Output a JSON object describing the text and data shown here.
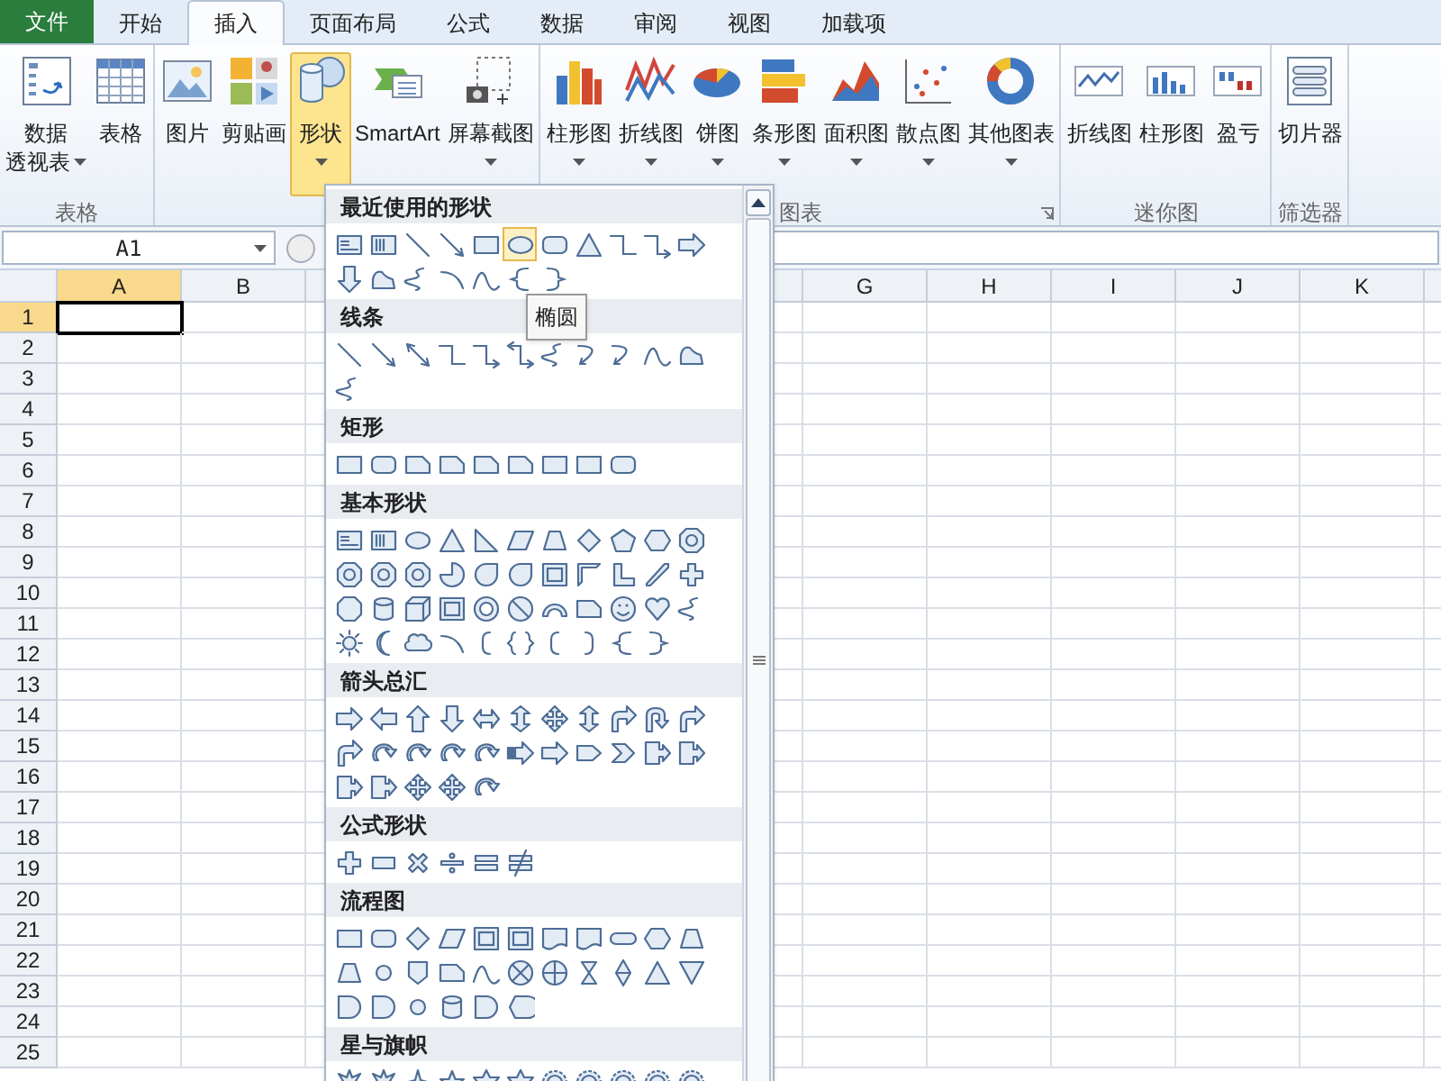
{
  "tabs": [
    {
      "label": "文件",
      "kind": "file",
      "selected": false
    },
    {
      "label": "开始",
      "kind": "tab",
      "selected": false
    },
    {
      "label": "插入",
      "kind": "tab",
      "selected": true
    },
    {
      "label": "页面布局",
      "kind": "tab",
      "selected": false
    },
    {
      "label": "公式",
      "kind": "tab",
      "selected": false
    },
    {
      "label": "数据",
      "kind": "tab",
      "selected": false
    },
    {
      "label": "审阅",
      "kind": "tab",
      "selected": false
    },
    {
      "label": "视图",
      "kind": "tab",
      "selected": false
    },
    {
      "label": "加载项",
      "kind": "tab",
      "selected": false
    }
  ],
  "ribbon_groups": [
    {
      "label": "表格",
      "launcher": false,
      "buttons": [
        {
          "kind": "pivot",
          "lines": [
            "数据",
            "透视表"
          ],
          "dropdown": true,
          "pressed": false
        },
        {
          "kind": "table",
          "lines": [
            "表格"
          ],
          "dropdown": false,
          "pressed": false
        }
      ]
    },
    {
      "launcher": false,
      "buttons": [
        {
          "kind": "picture",
          "lines": [
            "图片"
          ],
          "dropdown": false,
          "pressed": false
        },
        {
          "kind": "clipart",
          "lines": [
            "剪贴画"
          ],
          "dropdown": false,
          "pressed": false
        },
        {
          "kind": "shapes",
          "lines": [
            "形状"
          ],
          "dropdown": true,
          "pressed": true
        },
        {
          "kind": "smartart",
          "lines": [
            "SmartArt"
          ],
          "dropdown": false,
          "pressed": false
        },
        {
          "kind": "screenshot",
          "lines": [
            "屏幕截图"
          ],
          "dropdown": true,
          "pressed": false
        }
      ]
    },
    {
      "label": "图表",
      "launcher": true,
      "buttons": [
        {
          "kind": "column",
          "lines": [
            "柱形图"
          ],
          "dropdown": true,
          "pressed": false
        },
        {
          "kind": "line",
          "lines": [
            "折线图"
          ],
          "dropdown": true,
          "pressed": false
        },
        {
          "kind": "pie",
          "lines": [
            "饼图"
          ],
          "dropdown": true,
          "pressed": false
        },
        {
          "kind": "bar",
          "lines": [
            "条形图"
          ],
          "dropdown": true,
          "pressed": false
        },
        {
          "kind": "area",
          "lines": [
            "面积图"
          ],
          "dropdown": true,
          "pressed": false
        },
        {
          "kind": "scatter",
          "lines": [
            "散点图"
          ],
          "dropdown": true,
          "pressed": false
        },
        {
          "kind": "donut",
          "lines": [
            "其他图表"
          ],
          "dropdown": true,
          "pressed": false
        }
      ]
    },
    {
      "label": "迷你图",
      "launcher": false,
      "buttons": [
        {
          "kind": "sparkline",
          "lines": [
            "折线图"
          ],
          "dropdown": false,
          "pressed": false
        },
        {
          "kind": "sparkcolumn",
          "lines": [
            "柱形图"
          ],
          "dropdown": false,
          "pressed": false
        },
        {
          "kind": "winloss",
          "lines": [
            "盈亏"
          ],
          "dropdown": false,
          "pressed": false
        }
      ]
    },
    {
      "label": "筛选器",
      "launcher": false,
      "buttons": [
        {
          "kind": "slicer",
          "lines": [
            "切片器"
          ],
          "dropdown": false,
          "pressed": false
        }
      ]
    }
  ],
  "name_box": {
    "value": "A1"
  },
  "columns": [
    {
      "kind": "label",
      "label": "A",
      "selected": true
    },
    {
      "kind": "label",
      "label": "B",
      "selected": false
    },
    {
      "kind": "covered"
    },
    {
      "kind": "covered"
    },
    {
      "kind": "covered"
    },
    {
      "kind": "covered"
    },
    {
      "kind": "label",
      "label": "G",
      "selected": false
    },
    {
      "kind": "label",
      "label": "H",
      "selected": false
    },
    {
      "kind": "label",
      "label": "I",
      "selected": false
    },
    {
      "kind": "label",
      "label": "J",
      "selected": false
    },
    {
      "kind": "label",
      "label": "K",
      "selected": false
    }
  ],
  "rows": [
    {
      "label": "1",
      "selected": true
    },
    {
      "label": "2",
      "selected": false
    },
    {
      "label": "3",
      "selected": false
    },
    {
      "label": "4",
      "selected": false
    },
    {
      "label": "5",
      "selected": false
    },
    {
      "label": "6",
      "selected": false
    },
    {
      "label": "7",
      "selected": false
    },
    {
      "label": "8",
      "selected": false
    },
    {
      "label": "9",
      "selected": false
    },
    {
      "label": "10",
      "selected": false
    },
    {
      "label": "11",
      "selected": false
    },
    {
      "label": "12",
      "selected": false
    },
    {
      "label": "13",
      "selected": false
    },
    {
      "label": "14",
      "selected": false
    },
    {
      "label": "15",
      "selected": false
    },
    {
      "label": "16",
      "selected": false
    },
    {
      "label": "17",
      "selected": false
    },
    {
      "label": "18",
      "selected": false
    },
    {
      "label": "19",
      "selected": false
    },
    {
      "label": "20",
      "selected": false
    },
    {
      "label": "21",
      "selected": false
    },
    {
      "label": "22",
      "selected": false
    },
    {
      "label": "23",
      "selected": false
    },
    {
      "label": "24",
      "selected": false
    },
    {
      "label": "25",
      "selected": false
    }
  ],
  "shape_gallery": {
    "tooltip": "椭圆",
    "sections": [
      {
        "title": "最近使用的形状",
        "shapes": [
          {
            "kind": "textbox",
            "selected": false
          },
          {
            "kind": "vtextbox",
            "selected": false
          },
          {
            "kind": "line",
            "selected": false
          },
          {
            "kind": "arrowline",
            "selected": false
          },
          {
            "kind": "rect",
            "selected": false
          },
          {
            "kind": "ellipse",
            "selected": true
          },
          {
            "kind": "roundrect",
            "selected": false
          },
          {
            "kind": "triangle",
            "selected": false
          },
          {
            "kind": "elbow",
            "selected": false
          },
          {
            "kind": "elbowarrow",
            "selected": false
          },
          {
            "kind": "rightarrow",
            "selected": false
          },
          {
            "kind": "downarrow",
            "selected": false
          },
          {
            "kind": "freeform",
            "selected": false
          },
          {
            "kind": "scribble",
            "selected": false
          },
          {
            "kind": "curve",
            "selected": false
          },
          {
            "kind": "wave",
            "selected": false
          },
          {
            "kind": "bracel",
            "selected": false
          },
          {
            "kind": "bracer",
            "selected": false
          }
        ]
      },
      {
        "title": "线条"
      },
      {
        "title": "矩形"
      },
      {
        "title": "基本形状"
      },
      {
        "title": "箭头总汇"
      },
      {
        "title": "公式形状"
      },
      {
        "title": "流程图"
      },
      {
        "title": "星与旗帜"
      }
    ]
  }
}
